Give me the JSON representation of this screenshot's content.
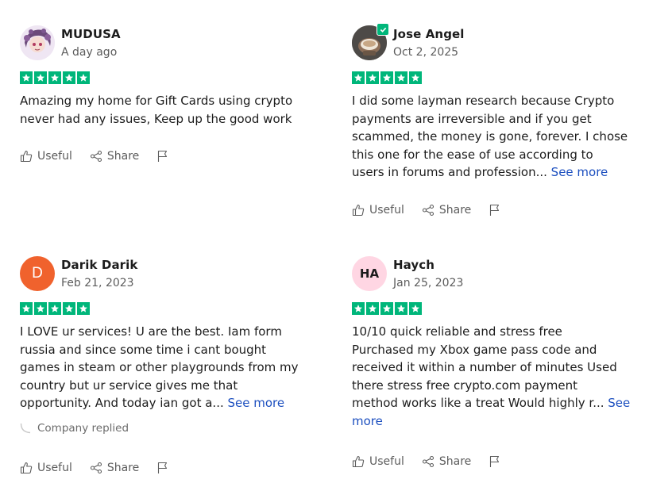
{
  "colors": {
    "star_green": "#00b67a",
    "link_blue": "#1c4fbf",
    "avatar_darik": "#f0622d",
    "avatar_haych_bg": "#ffd6e3"
  },
  "reviews": [
    {
      "name": "MUDUSA",
      "date": "A day ago",
      "rating": 5,
      "avatar": {
        "type": "image",
        "icon": "avatar-illustration"
      },
      "text": "Amazing my home for Gift Cards using crypto\nnever had any issues, Keep up the good work",
      "see_more": "",
      "useful_label": "Useful",
      "share_label": "Share"
    },
    {
      "name": "Jose Angel",
      "date": "Oct 2, 2025",
      "rating": 5,
      "verified": true,
      "avatar": {
        "type": "image",
        "icon": "avatar-photo"
      },
      "text": "I did some layman research because Crypto\npayments are irreversible and if you get\nscammed, the money is gone, forever. I chose\nthis one for the ease of use according to\nusers in forums and profession... ",
      "see_more": "See more",
      "useful_label": "Useful",
      "share_label": "Share"
    },
    {
      "name": "Darik Darik",
      "date": "Feb 21, 2023",
      "rating": 5,
      "avatar": {
        "type": "initials",
        "initials": "D"
      },
      "text": "I LOVE ur services! U are the best. Iam form\nrussia and since some time i cant bought\ngames in steam or other playgrounds from my\ncountry but ur service gives me that\nopportunity. And today ian got a... ",
      "see_more": "See more",
      "company_replied": "Company replied",
      "useful_label": "Useful",
      "share_label": "Share"
    },
    {
      "name": "Haych",
      "date": "Jan 25, 2023",
      "rating": 5,
      "avatar": {
        "type": "initials",
        "initials": "HA"
      },
      "text": "10/10 quick reliable and stress free\nPurchased my Xbox game pass code and\nreceived it within a number of minutes Used\nthere stress free crypto.com payment\nmethod works like a treat Would highly r... ",
      "see_more": "See\nmore",
      "useful_label": "Useful",
      "share_label": "Share"
    }
  ]
}
